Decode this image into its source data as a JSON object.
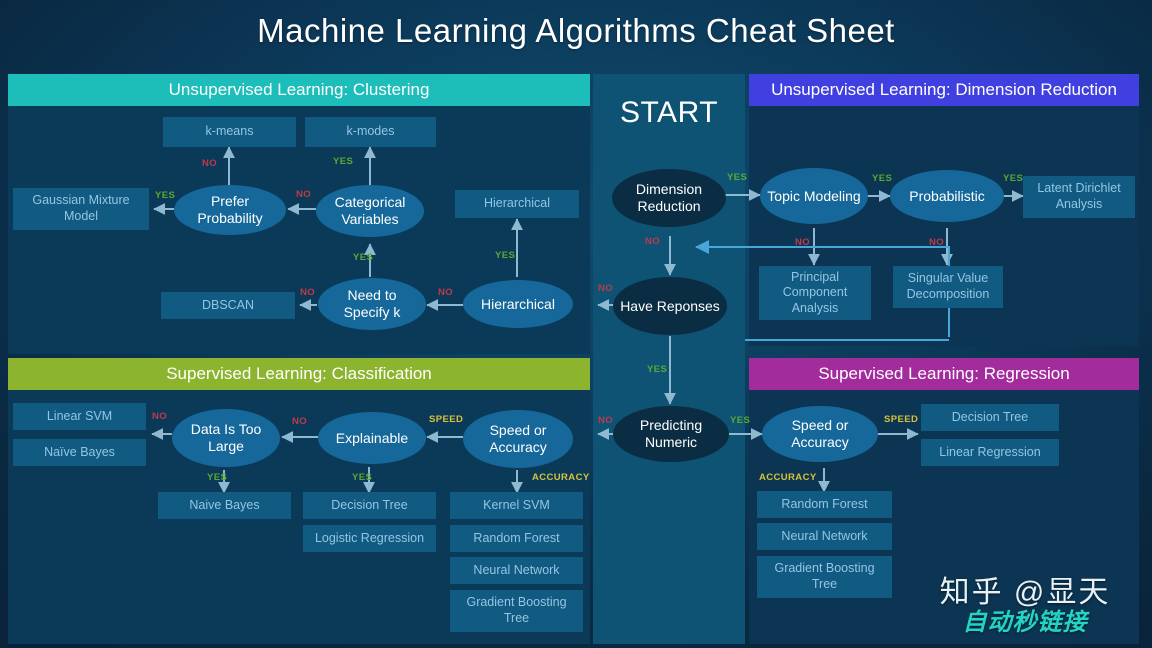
{
  "title": "Machine Learning Algorithms Cheat Sheet",
  "colors": {
    "clustering_header": "#1dbdba",
    "dimension_header": "#4040e0",
    "classification_header": "#8cb42f",
    "regression_header": "#a32c9c",
    "box_fill": "#115a82",
    "box_text": "#93c6e4",
    "ellipse_fill": "#16689a",
    "ellipse_text": "#ffffff",
    "yes_label": "#5aa832",
    "no_label": "#c0394b",
    "speed_label": "#d8c23a",
    "background": "#0d3f60"
  },
  "center": {
    "start_label": "START",
    "nodes": [
      {
        "name": "dimension-reduction",
        "label": "Dimension Reduction"
      },
      {
        "name": "have-responses",
        "label": "Have Reponses"
      },
      {
        "name": "predicting-numeric",
        "label": "Predicting Numeric"
      }
    ],
    "labels": {
      "dim_yes": "YES",
      "dim_no": "NO",
      "resp_no": "NO",
      "resp_yes": "YES",
      "pred_no": "NO",
      "pred_yes": "YES"
    }
  },
  "clustering": {
    "header": "Unsupervised Learning: Clustering",
    "boxes": [
      {
        "name": "k-means",
        "label": "k-means"
      },
      {
        "name": "k-modes",
        "label": "k-modes"
      },
      {
        "name": "gaussian-mixture-model",
        "label": "Gaussian Mixture Model"
      },
      {
        "name": "hierarchical-box",
        "label": "Hierarchical"
      },
      {
        "name": "dbscan",
        "label": "DBSCAN"
      }
    ],
    "ellipses": [
      {
        "name": "prefer-probability",
        "label": "Prefer Probability"
      },
      {
        "name": "categorical-variables",
        "label": "Categorical Variables"
      },
      {
        "name": "need-to-specify-k",
        "label": "Need to Specify k"
      },
      {
        "name": "hierarchical-decision",
        "label": "Hierarchical"
      }
    ],
    "labels": {
      "kmeans_no": "NO",
      "kmodes_yes": "YES",
      "gmm_yes": "YES",
      "cat_no": "NO",
      "specifyk_yes": "YES",
      "dbscan_no": "NO",
      "hier_yes": "YES",
      "hier_no": "NO"
    }
  },
  "dimension": {
    "header": "Unsupervised Learning: Dimension Reduction",
    "ellipses": [
      {
        "name": "topic-modeling",
        "label": "Topic Modeling"
      },
      {
        "name": "probabilistic",
        "label": "Probabilistic"
      }
    ],
    "boxes": [
      {
        "name": "latent-dirichlet-analysis",
        "label": "Latent Dirichlet Analysis"
      },
      {
        "name": "principal-component-analysis",
        "label": "Principal Component Analysis"
      },
      {
        "name": "singular-value-decomposition",
        "label": "Singular Value Decomposition"
      }
    ],
    "labels": {
      "topic_yes": "YES",
      "prob_yes": "YES",
      "topic_no": "NO",
      "prob_no": "NO"
    }
  },
  "classification": {
    "header": "Supervised Learning: Classification",
    "boxes": [
      {
        "name": "linear-svm",
        "label": "Linear SVM"
      },
      {
        "name": "naive-bayes-left",
        "label": "Naïve Bayes"
      },
      {
        "name": "naive-bayes-bottom",
        "label": "Naive Bayes"
      },
      {
        "name": "decision-tree",
        "label": "Decision Tree"
      },
      {
        "name": "logistic-regression",
        "label": "Logistic Regression"
      },
      {
        "name": "kernel-svm",
        "label": "Kernel SVM"
      },
      {
        "name": "random-forest",
        "label": "Random Forest"
      },
      {
        "name": "neural-network",
        "label": "Neural Network"
      },
      {
        "name": "gradient-boosting-tree",
        "label": "Gradient Boosting Tree"
      }
    ],
    "ellipses": [
      {
        "name": "data-is-too-large",
        "label": "Data Is Too Large"
      },
      {
        "name": "explainable",
        "label": "Explainable"
      },
      {
        "name": "speed-or-accuracy",
        "label": "Speed or Accuracy"
      }
    ],
    "labels": {
      "svm_no": "NO",
      "explain_no": "NO",
      "speed": "SPEED",
      "large_yes": "YES",
      "explain_yes": "YES",
      "accuracy": "ACCURACY"
    }
  },
  "regression": {
    "header": "Supervised Learning: Regression",
    "ellipses": [
      {
        "name": "speed-or-accuracy-reg",
        "label": "Speed or Accuracy"
      }
    ],
    "boxes": [
      {
        "name": "decision-tree-reg",
        "label": "Decision Tree"
      },
      {
        "name": "linear-regression",
        "label": "Linear Regression"
      },
      {
        "name": "random-forest-reg",
        "label": "Random Forest"
      },
      {
        "name": "neural-network-reg",
        "label": "Neural Network"
      },
      {
        "name": "gradient-boosting-tree-reg",
        "label": "Gradient Boosting Tree"
      }
    ],
    "labels": {
      "speed": "SPEED",
      "accuracy": "ACCURACY"
    }
  },
  "watermark": {
    "line1": "知乎 @显天",
    "line2": "自动秒链接"
  }
}
